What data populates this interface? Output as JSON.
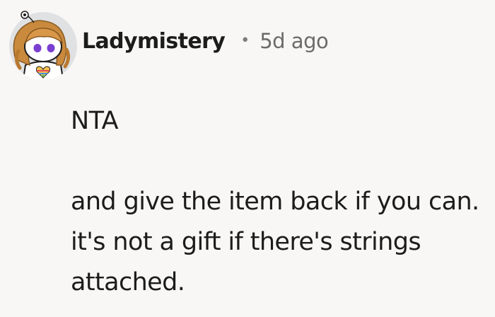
{
  "comment": {
    "author": "Ladymistery",
    "separator": "•",
    "timestamp": "5d ago",
    "avatar_icon": "reddit-snoo-avatar-icon",
    "paragraphs": [
      "NTA",
      "and give the item back if you can. it's not a gift if there's strings attached."
    ]
  },
  "colors": {
    "background": "#f8f7f5",
    "text": "#1c1c1c",
    "meta": "#6b6b6b",
    "hair": "#c98a3e",
    "eyes": "#7a3fd0"
  }
}
